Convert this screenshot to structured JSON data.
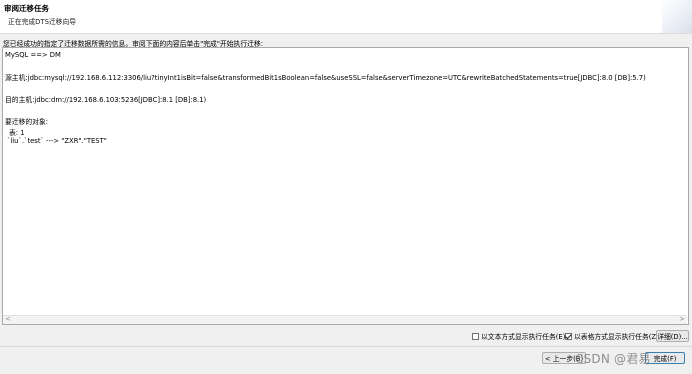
{
  "header": {
    "title": "审阅迁移任务",
    "subtitle": "正在完成DTS迁移向导"
  },
  "intro_text": "您已经成功的指定了迁移数据所需的信息。审阅下面的内容后单击\"完成\"开始执行迁移:",
  "details": {
    "direction": "MySQL ==> DM",
    "source": "源主机:jdbc:mysql://192.168.6.112:3306/liu?tinyInt1isBit=false&transformedBit1sBoolean=false&useSSL=false&serverTimezone=UTC&rewriteBatchedStatements=true[JDBC]:8.0 [DB]:5.7)",
    "target": "目的主机:jdbc:dm://192.168.6.103:5236[JDBC]:8.1 [DB]:8.1)",
    "objects_heading": "要迁移的对象:",
    "objects_count": "表: 1",
    "mapping": "`liu`.`test` ---> \"ZXR\".\"TEST\""
  },
  "scrollbar": {
    "left_arrow": "<",
    "right_arrow": ">"
  },
  "options": {
    "text_mode_label": "以文本方式显示执行任务(E)",
    "text_mode_checked": false,
    "table_mode_label": "以表格方式显示执行任务(Z)",
    "table_mode_checked": true,
    "details_button": "详细(D)..."
  },
  "footer": {
    "back_button": "< 上一步(B)",
    "finish_button": "完成(F)",
    "watermark": "CSDN @君易"
  }
}
